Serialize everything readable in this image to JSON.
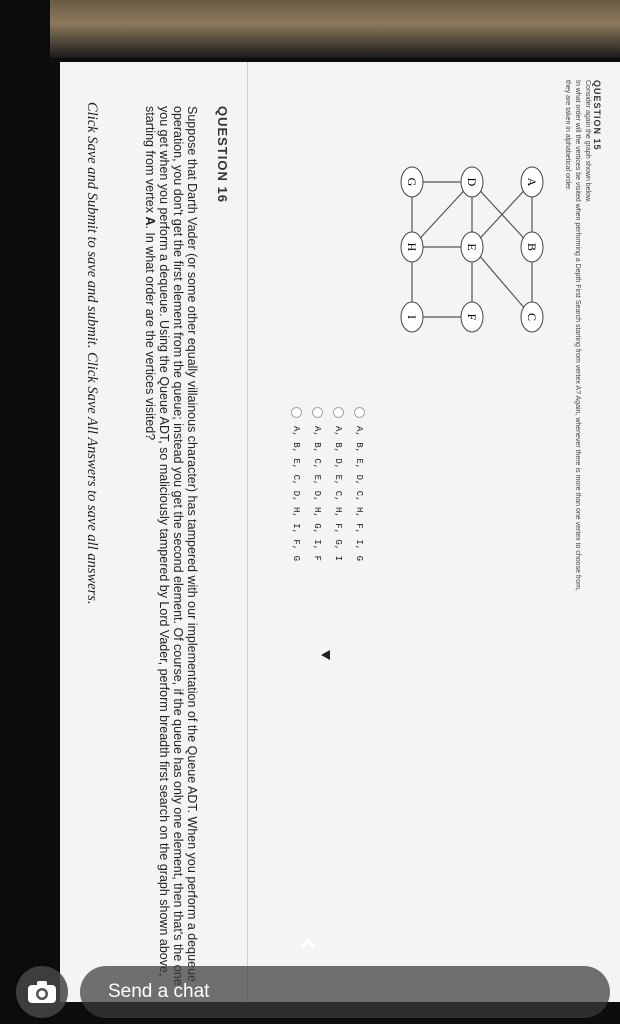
{
  "question15": {
    "title": "QUESTION 15",
    "prompt_lines": [
      "Consider again the graph shown below.",
      "In what order will the vertices be visited when performing a Depth First Search starting from vertex A? Again, whenever there is more than one vertex to choose from,",
      "they are taken in alphabetical order."
    ],
    "graph_nodes": [
      "A",
      "B",
      "C",
      "D",
      "E",
      "F",
      "G",
      "H",
      "I"
    ],
    "options": [
      "A, B, E, D, C, H, F, I, G",
      "A, B, D, E, C, H, F, G, I",
      "A, B, C, E, D, H, G, I, F",
      "A, B, E, C, D, H, I, F, G"
    ]
  },
  "question16": {
    "title": "QUESTION 16",
    "body_prefix": "Suppose that Darth Vader (or some other equally villainous character) has tampered with our implementation of the Queue ADT. When you perform a dequeue operation, you don't get the first element from the queue; instead you get the second element. Of course, if the queue has only one element, then that's the one you get when you perform a dequeue. Using the Queue ADT, so maliciously tampered by Lord Vader, perform breadth first search on the graph shown above, starting from vertex ",
    "body_vertex": "A",
    "body_suffix": ". In what order are the vertices visited?"
  },
  "footer": {
    "text": "Click Save and Submit to save and submit. Click Save All Answers to save all answers."
  },
  "overlay": {
    "chat_label": "Send a chat",
    "camera_icon": "camera-icon",
    "chevron_icon": "chevron-up-icon"
  }
}
